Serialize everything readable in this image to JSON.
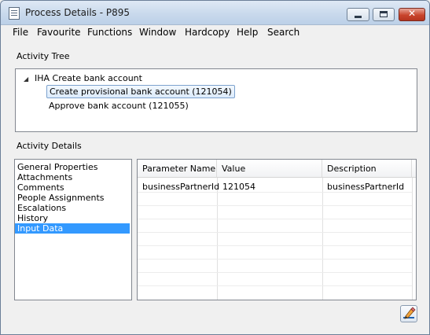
{
  "window": {
    "title": "Process Details - P895",
    "close_symbol": "✕"
  },
  "menu": [
    "File",
    "Favourite",
    "Functions",
    "Window",
    "Hardcopy",
    "Help",
    "Search"
  ],
  "activity_tree": {
    "label": "Activity Tree",
    "root": "IHA Create bank account",
    "children": [
      "Create provisional bank account (121054)",
      "Approve bank account (121055)"
    ],
    "selected_index": 0
  },
  "activity_details": {
    "label": "Activity Details",
    "items": [
      "General Properties",
      "Attachments",
      "Comments",
      "People Assignments",
      "Escalations",
      "History",
      "Input Data"
    ],
    "selected_index": 6
  },
  "input_data_table": {
    "columns": [
      "Parameter Name",
      "Value",
      "Description"
    ],
    "rows": [
      [
        "businessPartnerId",
        "121054",
        "businessPartnerId"
      ]
    ]
  },
  "icons": {
    "edit": "pencil-edit-icon"
  }
}
